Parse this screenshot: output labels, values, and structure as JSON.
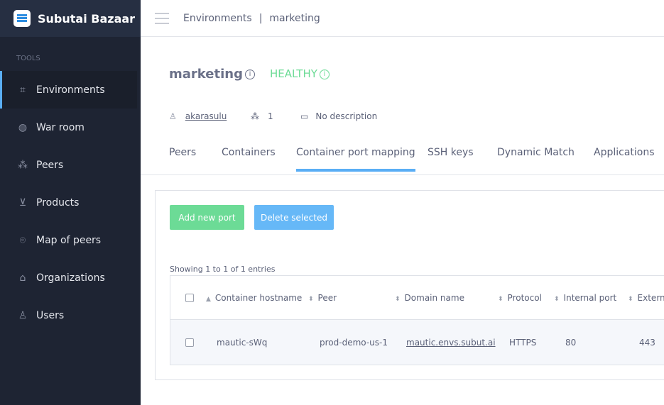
{
  "brand": {
    "name": "Subutai Bazaar"
  },
  "sidebar": {
    "section": "TOOLS",
    "items": [
      {
        "label": "Environments",
        "icon": "environments-icon"
      },
      {
        "label": "War room",
        "icon": "globe-icon"
      },
      {
        "label": "Peers",
        "icon": "peers-icon"
      },
      {
        "label": "Products",
        "icon": "basket-icon"
      },
      {
        "label": "Map of peers",
        "icon": "map-pin-icon"
      },
      {
        "label": "Organizations",
        "icon": "bank-icon"
      },
      {
        "label": "Users",
        "icon": "users-icon"
      }
    ]
  },
  "breadcrumb": {
    "root": "Environments",
    "current": "marketing"
  },
  "env": {
    "name": "marketing",
    "status": "HEALTHY",
    "owner": "akarasulu",
    "peer_count": "1",
    "description": "No description"
  },
  "tabs": [
    "Peers",
    "Containers",
    "Container port mapping",
    "SSH keys",
    "Dynamic Match",
    "Applications"
  ],
  "buttons": {
    "add": "Add new port",
    "delete": "Delete selected"
  },
  "table": {
    "showing": "Showing 1 to 1 of 1 entries",
    "columns": [
      "Container hostname",
      "Peer",
      "Domain name",
      "Protocol",
      "Internal port",
      "Extern"
    ],
    "rows": [
      [
        "mautic-sWq",
        "prod-demo-us-1",
        "mautic.envs.subut.ai",
        "HTTPS",
        "80",
        "443"
      ]
    ]
  },
  "colors": {
    "accent": "#5aaef5",
    "healthy": "#6ddb96",
    "sidebar": "#1e2433"
  }
}
